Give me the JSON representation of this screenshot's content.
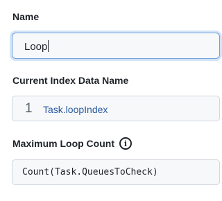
{
  "name_field": {
    "label": "Name",
    "value": "Loop"
  },
  "index_field": {
    "label": "Current Index Data Name",
    "line_number": "1",
    "value": "Task.loopIndex"
  },
  "max_field": {
    "label": "Maximum Loop Count",
    "info_icon": "info-icon",
    "value": "Count(Task.QueuesToCheck)"
  },
  "colors": {
    "focus_border": "#6fa0d8",
    "link_text": "#2b5aa0",
    "input_background": "#f6f8fa"
  }
}
